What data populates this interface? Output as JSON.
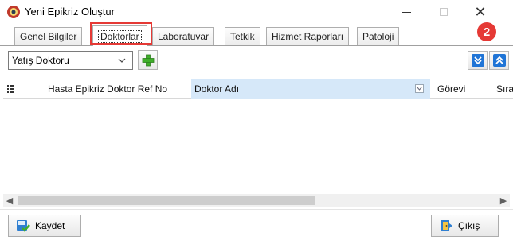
{
  "window": {
    "title": "Yeni Epikriz Oluştur",
    "minimize_label": "—",
    "maximize_label": "",
    "close_label": "✕"
  },
  "tabs": [
    {
      "label": "Genel Bilgiler"
    },
    {
      "label": "Doktorlar"
    },
    {
      "label": "Laboratuvar"
    },
    {
      "label": "Tetkik"
    },
    {
      "label": "Hizmet Raporları"
    },
    {
      "label": "Patoloji"
    }
  ],
  "active_tab": "Doktorlar",
  "annotation": {
    "badge": "2"
  },
  "toolbar": {
    "doctor_type_selected": "Yatış Doktoru"
  },
  "grid": {
    "columns": [
      "Hasta Epikriz Doktor Ref No",
      "Doktor Adı",
      "Görevi",
      "Sıra"
    ],
    "rows": []
  },
  "footer": {
    "save_label": "Kaydet",
    "exit_label": "Çıkış"
  },
  "colors": {
    "highlight": "#e53935",
    "accent_blue": "#1f74d6",
    "selected_column": "#d6e8f9"
  }
}
